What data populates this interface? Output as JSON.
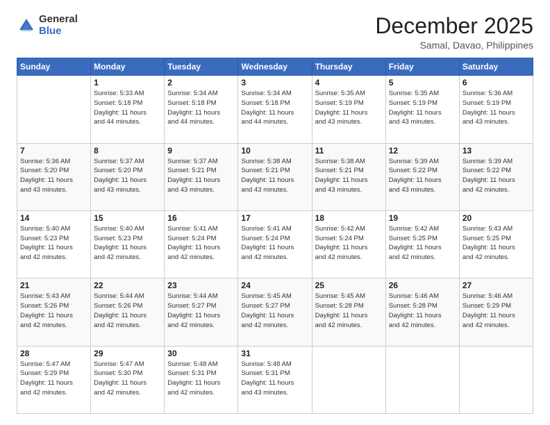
{
  "header": {
    "logo_general": "General",
    "logo_blue": "Blue",
    "main_title": "December 2025",
    "subtitle": "Samal, Davao, Philippines"
  },
  "calendar": {
    "columns": [
      "Sunday",
      "Monday",
      "Tuesday",
      "Wednesday",
      "Thursday",
      "Friday",
      "Saturday"
    ],
    "weeks": [
      {
        "days": [
          {
            "num": "",
            "info": ""
          },
          {
            "num": "1",
            "info": "Sunrise: 5:33 AM\nSunset: 5:18 PM\nDaylight: 11 hours\nand 44 minutes."
          },
          {
            "num": "2",
            "info": "Sunrise: 5:34 AM\nSunset: 5:18 PM\nDaylight: 11 hours\nand 44 minutes."
          },
          {
            "num": "3",
            "info": "Sunrise: 5:34 AM\nSunset: 5:18 PM\nDaylight: 11 hours\nand 44 minutes."
          },
          {
            "num": "4",
            "info": "Sunrise: 5:35 AM\nSunset: 5:19 PM\nDaylight: 11 hours\nand 43 minutes."
          },
          {
            "num": "5",
            "info": "Sunrise: 5:35 AM\nSunset: 5:19 PM\nDaylight: 11 hours\nand 43 minutes."
          },
          {
            "num": "6",
            "info": "Sunrise: 5:36 AM\nSunset: 5:19 PM\nDaylight: 11 hours\nand 43 minutes."
          }
        ]
      },
      {
        "days": [
          {
            "num": "7",
            "info": "Sunrise: 5:36 AM\nSunset: 5:20 PM\nDaylight: 11 hours\nand 43 minutes."
          },
          {
            "num": "8",
            "info": "Sunrise: 5:37 AM\nSunset: 5:20 PM\nDaylight: 11 hours\nand 43 minutes."
          },
          {
            "num": "9",
            "info": "Sunrise: 5:37 AM\nSunset: 5:21 PM\nDaylight: 11 hours\nand 43 minutes."
          },
          {
            "num": "10",
            "info": "Sunrise: 5:38 AM\nSunset: 5:21 PM\nDaylight: 11 hours\nand 43 minutes."
          },
          {
            "num": "11",
            "info": "Sunrise: 5:38 AM\nSunset: 5:21 PM\nDaylight: 11 hours\nand 43 minutes."
          },
          {
            "num": "12",
            "info": "Sunrise: 5:39 AM\nSunset: 5:22 PM\nDaylight: 11 hours\nand 43 minutes."
          },
          {
            "num": "13",
            "info": "Sunrise: 5:39 AM\nSunset: 5:22 PM\nDaylight: 11 hours\nand 42 minutes."
          }
        ]
      },
      {
        "days": [
          {
            "num": "14",
            "info": "Sunrise: 5:40 AM\nSunset: 5:23 PM\nDaylight: 11 hours\nand 42 minutes."
          },
          {
            "num": "15",
            "info": "Sunrise: 5:40 AM\nSunset: 5:23 PM\nDaylight: 11 hours\nand 42 minutes."
          },
          {
            "num": "16",
            "info": "Sunrise: 5:41 AM\nSunset: 5:24 PM\nDaylight: 11 hours\nand 42 minutes."
          },
          {
            "num": "17",
            "info": "Sunrise: 5:41 AM\nSunset: 5:24 PM\nDaylight: 11 hours\nand 42 minutes."
          },
          {
            "num": "18",
            "info": "Sunrise: 5:42 AM\nSunset: 5:24 PM\nDaylight: 11 hours\nand 42 minutes."
          },
          {
            "num": "19",
            "info": "Sunrise: 5:42 AM\nSunset: 5:25 PM\nDaylight: 11 hours\nand 42 minutes."
          },
          {
            "num": "20",
            "info": "Sunrise: 5:43 AM\nSunset: 5:25 PM\nDaylight: 11 hours\nand 42 minutes."
          }
        ]
      },
      {
        "days": [
          {
            "num": "21",
            "info": "Sunrise: 5:43 AM\nSunset: 5:26 PM\nDaylight: 11 hours\nand 42 minutes."
          },
          {
            "num": "22",
            "info": "Sunrise: 5:44 AM\nSunset: 5:26 PM\nDaylight: 11 hours\nand 42 minutes."
          },
          {
            "num": "23",
            "info": "Sunrise: 5:44 AM\nSunset: 5:27 PM\nDaylight: 11 hours\nand 42 minutes."
          },
          {
            "num": "24",
            "info": "Sunrise: 5:45 AM\nSunset: 5:27 PM\nDaylight: 11 hours\nand 42 minutes."
          },
          {
            "num": "25",
            "info": "Sunrise: 5:45 AM\nSunset: 5:28 PM\nDaylight: 11 hours\nand 42 minutes."
          },
          {
            "num": "26",
            "info": "Sunrise: 5:46 AM\nSunset: 5:28 PM\nDaylight: 11 hours\nand 42 minutes."
          },
          {
            "num": "27",
            "info": "Sunrise: 5:46 AM\nSunset: 5:29 PM\nDaylight: 11 hours\nand 42 minutes."
          }
        ]
      },
      {
        "days": [
          {
            "num": "28",
            "info": "Sunrise: 5:47 AM\nSunset: 5:29 PM\nDaylight: 11 hours\nand 42 minutes."
          },
          {
            "num": "29",
            "info": "Sunrise: 5:47 AM\nSunset: 5:30 PM\nDaylight: 11 hours\nand 42 minutes."
          },
          {
            "num": "30",
            "info": "Sunrise: 5:48 AM\nSunset: 5:31 PM\nDaylight: 11 hours\nand 42 minutes."
          },
          {
            "num": "31",
            "info": "Sunrise: 5:48 AM\nSunset: 5:31 PM\nDaylight: 11 hours\nand 43 minutes."
          },
          {
            "num": "",
            "info": ""
          },
          {
            "num": "",
            "info": ""
          },
          {
            "num": "",
            "info": ""
          }
        ]
      }
    ]
  }
}
